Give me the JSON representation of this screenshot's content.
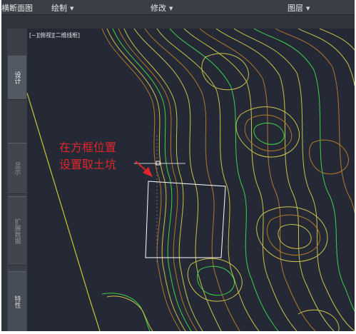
{
  "menubar": {
    "items": [
      {
        "label": "横断面图",
        "has_menu": false
      },
      {
        "label": "绘制",
        "has_menu": true
      },
      {
        "label": "修改",
        "has_menu": true
      },
      {
        "label": "图层",
        "has_menu": true
      }
    ]
  },
  "left_panel": {
    "tabs": [
      {
        "label": "设计",
        "state": "active"
      },
      {
        "label": "显示",
        "state": "dim"
      },
      {
        "label": "扩展数据",
        "state": "dim"
      },
      {
        "label": "特性",
        "state": "normal"
      }
    ]
  },
  "viewport": {
    "label": "[−][俯视][二维线框]"
  },
  "annotation": {
    "line1": "在方框位置",
    "line2": "设置取土坑",
    "color": "#e0262a"
  },
  "colors": {
    "canvas_background": "#242935",
    "contour_major": "#c8c24a",
    "contour_minor": "#b0782a",
    "contour_index": "#3fd24a",
    "boundary_line": "#c7c733",
    "selection_box": "#ffffff"
  },
  "icons": [
    "caret-down-icon",
    "arrow-icon",
    "grip-point-icon"
  ]
}
